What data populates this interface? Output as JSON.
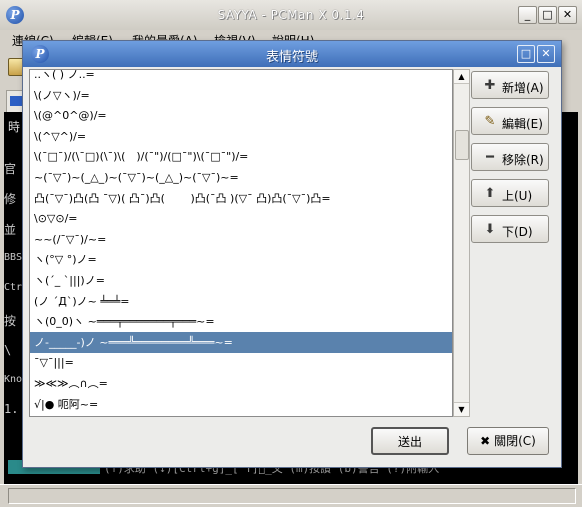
{
  "main_window": {
    "title": "SAYYA - PCMan X 0.1.4",
    "icon_letter": "P",
    "menus": [
      "連線(C)",
      "編輯(E)",
      "我的最愛(A)",
      "檢視(V)",
      "說明(H)"
    ],
    "terminal_lines": [
      "官",
      "修",
      "並",
      "BBS",
      "Ctr",
      "按",
      "\\",
      "Kno",
      "1."
    ],
    "status_text": "(↑)求助 (↓)[Ctrl+g]̲[^Y]發̲文 (m)按讚 (b)警告 (?)附輸入"
  },
  "dialog": {
    "title": "表情符號",
    "icon_letter": "P",
    "selected_index": 13,
    "items": [
      "..ヽ(      ) ノ..=",
      "\\(ノ▽ヽ)/=",
      "\\(@^0^@)/=",
      "\\(^▽^)/=",
      "\\(¯□¯)/(\\¯□)(\\¯)\\(　)/(¯\")/(□¯\")\\(¯□¯\")/=",
      "~(¯▽¯)~(_△_)~(¯▽¯)~(_△_)~(¯▽¯)~=",
      "凸(¯▽¯)凸(凸 ¯▽)(  凸¯)凸(　　 )凸(¯凸  )(▽¯ 凸)凸(¯▽¯)凸=",
      "\\⊙▽⊙/=",
      "~~(/¯▽¯)/~=",
      "ヽ(°▽  °)ノ=",
      "ヽ(´_ `|||)ノ=",
      "(ノ ´Д`)ノ~ ╧═╧=",
      "ヽ(0_0)ヽ ~═══╤═══════╤═══~=",
      "ノ-_____-)ノ ~═══╩════════╩═══~=",
      "¯▽¯|||=",
      "≫≪≫︵∩︵=",
      "√|● 呃阿~="
    ],
    "side_buttons": [
      {
        "label": "新增(A)",
        "icon": "plus-icon",
        "glyph": "✚"
      },
      {
        "label": "編輯(E)",
        "icon": "edit-icon",
        "glyph": "✎"
      },
      {
        "label": "移除(R)",
        "icon": "minus-icon",
        "glyph": "━"
      },
      {
        "label": "上(U)",
        "icon": "arrow-up-icon",
        "glyph": "⬆"
      },
      {
        "label": "下(D)",
        "icon": "arrow-down-icon",
        "glyph": "⬇"
      }
    ],
    "send_label": "送出",
    "close_label": "關閉(C)",
    "close_glyph": "✖"
  }
}
